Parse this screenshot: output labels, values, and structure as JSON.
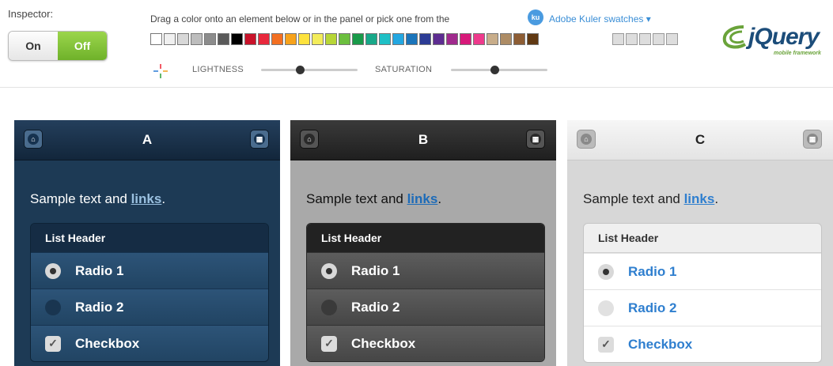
{
  "inspector": {
    "label": "Inspector:",
    "on": "On",
    "off": "Off"
  },
  "toolbar": {
    "drag_text": "Drag a color onto an element below or in the panel or pick one from the",
    "kuler_badge": "ku",
    "kuler_link": "Adobe Kuler swatches ▾",
    "swatch_colors": [
      "#ffffff",
      "#f0f0f0",
      "#d8d8d8",
      "#bdbdbd",
      "#8c8c8c",
      "#5a5a5a",
      "#000000",
      "#c9132a",
      "#e8283c",
      "#f36f21",
      "#f7a21b",
      "#fde23d",
      "#f3ec5a",
      "#b7d637",
      "#6cbf3f",
      "#199a49",
      "#18a889",
      "#1fc0c6",
      "#23a7e1",
      "#1b75bb",
      "#2c3c95",
      "#5d2d91",
      "#a02a8d",
      "#d7197a",
      "#ee3a8c",
      "#c8ad8a",
      "#ad8c65",
      "#8d5d34",
      "#603913"
    ],
    "recent_swatch_colors": [
      "#dddddd",
      "#dddddd",
      "#dddddd",
      "#dddddd",
      "#dddddd"
    ],
    "lightness_label": "LIGHTNESS",
    "saturation_label": "SATURATION",
    "lightness_value": 0.4,
    "saturation_value": 0.45
  },
  "logo": {
    "word": "jQuery",
    "sub": "mobile framework"
  },
  "panels": [
    {
      "title": "A",
      "sample_text": "Sample text and ",
      "link": "links",
      "tail": ".",
      "list_header": "List Header",
      "items": [
        "Radio 1",
        "Radio 2",
        "Checkbox"
      ]
    },
    {
      "title": "B",
      "sample_text": "Sample text and ",
      "link": "links",
      "tail": ".",
      "list_header": "List Header",
      "items": [
        "Radio 1",
        "Radio 2",
        "Checkbox"
      ]
    },
    {
      "title": "C",
      "sample_text": "Sample text and ",
      "link": "links",
      "tail": ".",
      "list_header": "List Header",
      "items": [
        "Radio 1",
        "Radio 2",
        "Checkbox"
      ]
    }
  ]
}
